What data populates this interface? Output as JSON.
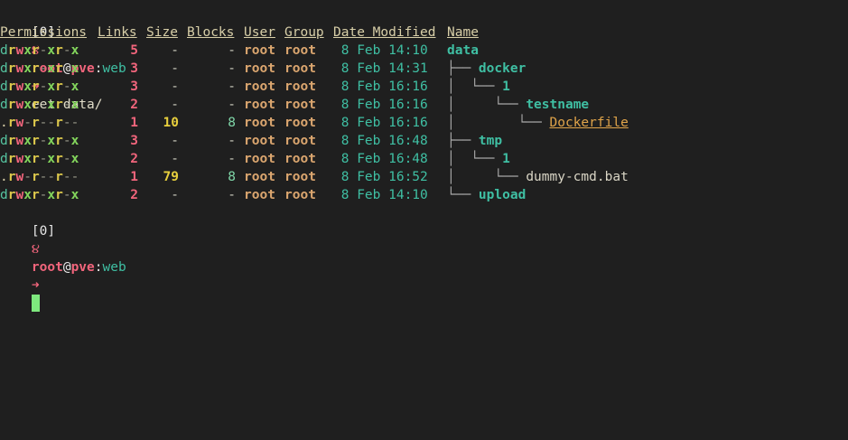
{
  "prompt": {
    "window": "[0]",
    "swirl": "૪",
    "user": "root",
    "at": "@",
    "host": "pve",
    "colon": ":",
    "dir": "web",
    "arrow": "➜",
    "command": "eet data/"
  },
  "headers": {
    "permissions": "Permissions",
    "links": "Links",
    "size": "Size",
    "blocks": "Blocks",
    "user": "User",
    "group": "Group",
    "date": "Date Modified",
    "name": "Name"
  },
  "rows": [
    {
      "p0": "d",
      "p1": "r",
      "p2": "w",
      "p3": "x",
      "p4": "r",
      "p5": "-",
      "p6": "x",
      "p7": "r",
      "p8": "-",
      "p9": "x",
      "links": "5",
      "size": "-",
      "blocks": "-",
      "user": "root",
      "group": "root",
      "date": " 8 Feb 14:10",
      "tree": "",
      "name": "data",
      "kind": "dir"
    },
    {
      "p0": "d",
      "p1": "r",
      "p2": "w",
      "p3": "x",
      "p4": "r",
      "p5": "-",
      "p6": "x",
      "p7": "r",
      "p8": "-",
      "p9": "x",
      "links": "3",
      "size": "-",
      "blocks": "-",
      "user": "root",
      "group": "root",
      "date": " 8 Feb 14:31",
      "tree": "├── ",
      "name": "docker",
      "kind": "dir"
    },
    {
      "p0": "d",
      "p1": "r",
      "p2": "w",
      "p3": "x",
      "p4": "r",
      "p5": "-",
      "p6": "x",
      "p7": "r",
      "p8": "-",
      "p9": "x",
      "links": "3",
      "size": "-",
      "blocks": "-",
      "user": "root",
      "group": "root",
      "date": " 8 Feb 16:16",
      "tree": "│  └── ",
      "name": "1",
      "kind": "dir"
    },
    {
      "p0": "d",
      "p1": "r",
      "p2": "w",
      "p3": "x",
      "p4": "r",
      "p5": "-",
      "p6": "x",
      "p7": "r",
      "p8": "-",
      "p9": "x",
      "links": "2",
      "size": "-",
      "blocks": "-",
      "user": "root",
      "group": "root",
      "date": " 8 Feb 16:16",
      "tree": "│     └── ",
      "name": "testname",
      "kind": "dir"
    },
    {
      "p0": ".",
      "p1": "r",
      "p2": "w",
      "p3": "-",
      "p4": "r",
      "p5": "-",
      "p6": "-",
      "p7": "r",
      "p8": "-",
      "p9": "-",
      "links": "1",
      "size": "10",
      "blocks": "8",
      "user": "root",
      "group": "root",
      "date": " 8 Feb 16:16",
      "tree": "│        └── ",
      "name": "Dockerfile",
      "kind": "docker"
    },
    {
      "p0": "d",
      "p1": "r",
      "p2": "w",
      "p3": "x",
      "p4": "r",
      "p5": "-",
      "p6": "x",
      "p7": "r",
      "p8": "-",
      "p9": "x",
      "links": "3",
      "size": "-",
      "blocks": "-",
      "user": "root",
      "group": "root",
      "date": " 8 Feb 16:48",
      "tree": "├── ",
      "name": "tmp",
      "kind": "dir"
    },
    {
      "p0": "d",
      "p1": "r",
      "p2": "w",
      "p3": "x",
      "p4": "r",
      "p5": "-",
      "p6": "x",
      "p7": "r",
      "p8": "-",
      "p9": "x",
      "links": "2",
      "size": "-",
      "blocks": "-",
      "user": "root",
      "group": "root",
      "date": " 8 Feb 16:48",
      "tree": "│  └── ",
      "name": "1",
      "kind": "dir"
    },
    {
      "p0": ".",
      "p1": "r",
      "p2": "w",
      "p3": "-",
      "p4": "r",
      "p5": "-",
      "p6": "-",
      "p7": "r",
      "p8": "-",
      "p9": "-",
      "links": "1",
      "size": "79",
      "blocks": "8",
      "user": "root",
      "group": "root",
      "date": " 8 Feb 16:52",
      "tree": "│     └── ",
      "name": "dummy-cmd.bat",
      "kind": "file"
    },
    {
      "p0": "d",
      "p1": "r",
      "p2": "w",
      "p3": "x",
      "p4": "r",
      "p5": "-",
      "p6": "x",
      "p7": "r",
      "p8": "-",
      "p9": "x",
      "links": "2",
      "size": "-",
      "blocks": "-",
      "user": "root",
      "group": "root",
      "date": " 8 Feb 14:10",
      "tree": "└── ",
      "name": "upload",
      "kind": "dir"
    }
  ],
  "prompt2": {
    "window": "[0]",
    "swirl": "૪",
    "user": "root",
    "at": "@",
    "host": "pve",
    "colon": ":",
    "dir": "web",
    "arrow": "➜"
  }
}
